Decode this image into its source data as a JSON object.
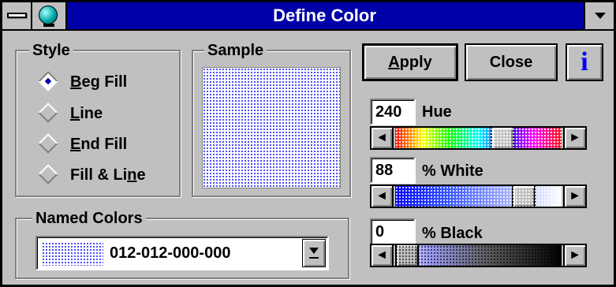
{
  "window": {
    "title": "Define Color"
  },
  "style_group": {
    "label": "Style",
    "options": [
      {
        "label_u": "B",
        "label_rest": "eg Fill",
        "selected": true
      },
      {
        "label_u": "L",
        "label_rest": "ine",
        "selected": false
      },
      {
        "label_u": "E",
        "label_rest": "nd Fill",
        "selected": false
      },
      {
        "label_pre": "Fill & Li",
        "label_u": "n",
        "label_rest": "e",
        "selected": false
      }
    ]
  },
  "sample_group": {
    "label": "Sample"
  },
  "buttons": {
    "apply_u": "A",
    "apply_rest": "pply",
    "close": "Close",
    "info": "i"
  },
  "sliders": {
    "hue": {
      "value": "240",
      "label": "Hue",
      "position": 0.67
    },
    "white": {
      "value": "88",
      "label": "% White",
      "position": 0.82
    },
    "black": {
      "value": "0",
      "label": "% Black",
      "position": 0.0
    }
  },
  "named_colors": {
    "label": "Named Colors",
    "selected": "012-012-000-000"
  },
  "colors": {
    "title_bar": "#0000a8",
    "face": "#c0c0c0",
    "sample_dots": "#2020ff"
  }
}
